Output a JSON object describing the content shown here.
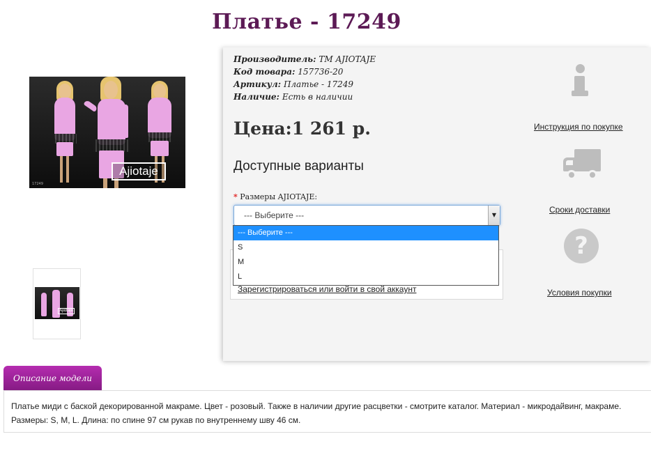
{
  "product": {
    "title": "Платье - 17249",
    "specs": [
      {
        "label": "Производитель:",
        "value": "ТМ AJIOTAJE"
      },
      {
        "label": "Код товара:",
        "value": "157736-20"
      },
      {
        "label": "Артикул:",
        "value": "Платье - 17249"
      },
      {
        "label": "Наличие:",
        "value": "Есть в наличии"
      }
    ],
    "price": "Цена:1 261 р.",
    "photo_logo": "Ajiotaje",
    "photo_caption": "17249",
    "thumb_logo": "Ajiotaje"
  },
  "variants": {
    "title": "Доступные варианты",
    "required_mark": "*",
    "size_label": "Размеры AJIOTAJE:",
    "select_value": "--- Выберите ---",
    "options": [
      "--- Выберите ---",
      "S",
      "M",
      "L"
    ],
    "selected_index": 0
  },
  "account": {
    "login_link": "Зарегистрироваться или войти в свой аккаунт"
  },
  "sidebar": {
    "links": [
      {
        "label": "Инструкция по покупке",
        "icon": "info-icon"
      },
      {
        "label": "Сроки доставки",
        "icon": "truck-icon"
      },
      {
        "label": "Условия покупки",
        "icon": "question-icon"
      }
    ]
  },
  "description": {
    "tab_label": "Описание модели",
    "text": "Платье миди с баской декорированной макраме. Цвет - розовый. Также в наличии другие расцветки - смотрите каталог. Материал - микродайвинг, макраме. Размеры: S, M, L. Длина: по спине 97 см рукав по внутреннему шву 46 см."
  },
  "colors": {
    "title": "#5c1a55",
    "tab": "#9e24a0",
    "select_highlight": "#1e90ff",
    "icon_gray": "#bdbdbd"
  }
}
